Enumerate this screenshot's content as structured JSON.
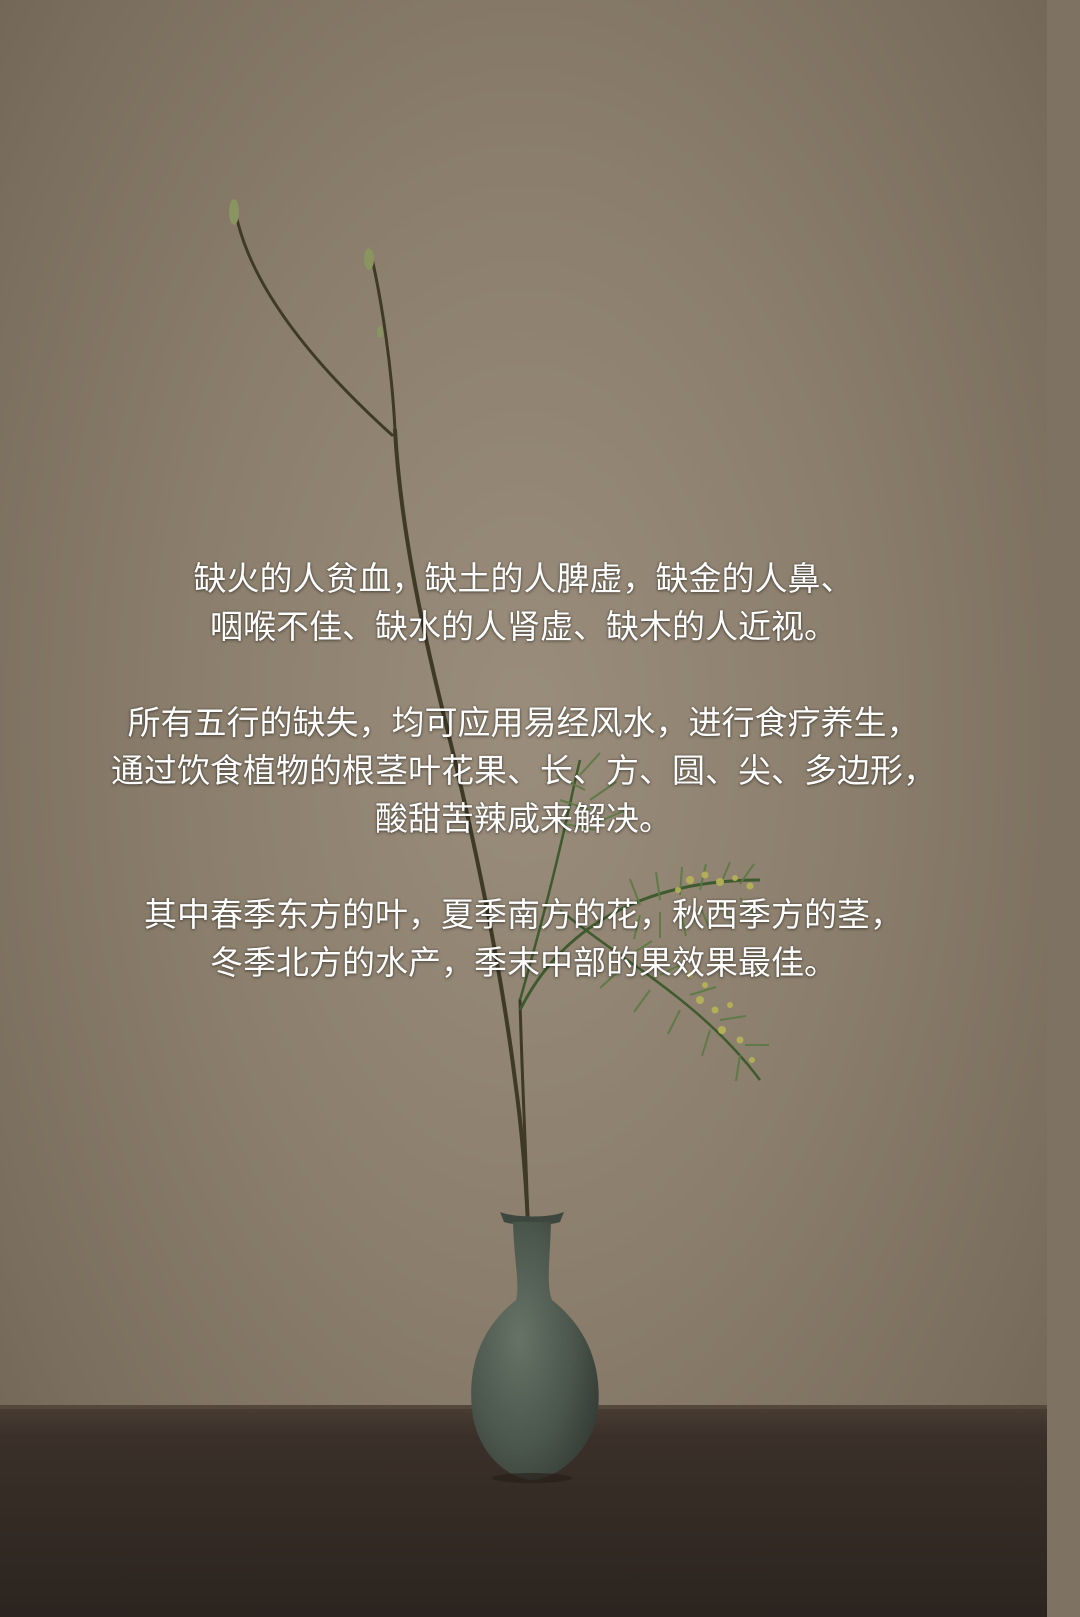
{
  "paragraphs": [
    {
      "lines": [
        "缺火的人贫血，缺土的人脾虚，缺金的人鼻、",
        "咽喉不佳、缺水的人肾虚、缺木的人近视。"
      ]
    },
    {
      "lines": [
        "所有五行的缺失，均可应用易经风水，进行食疗养生，",
        "通过饮食植物的根茎叶花果、长、方、圆、尖、多边形，",
        "酸甜苦辣咸来解决。"
      ]
    },
    {
      "lines": [
        "其中春季东方的叶，夏季南方的花，秋西季方的茎，",
        "冬季北方的水产，季末中部的果效果最佳。"
      ]
    }
  ],
  "colors": {
    "wall": "#8b7e6c",
    "table": "#3a3029",
    "vase": "#4e5a50",
    "stem": "#3e3a26",
    "leaf": "#4f6b3a",
    "blossom": "#b7b456",
    "text": "#ffffff"
  }
}
